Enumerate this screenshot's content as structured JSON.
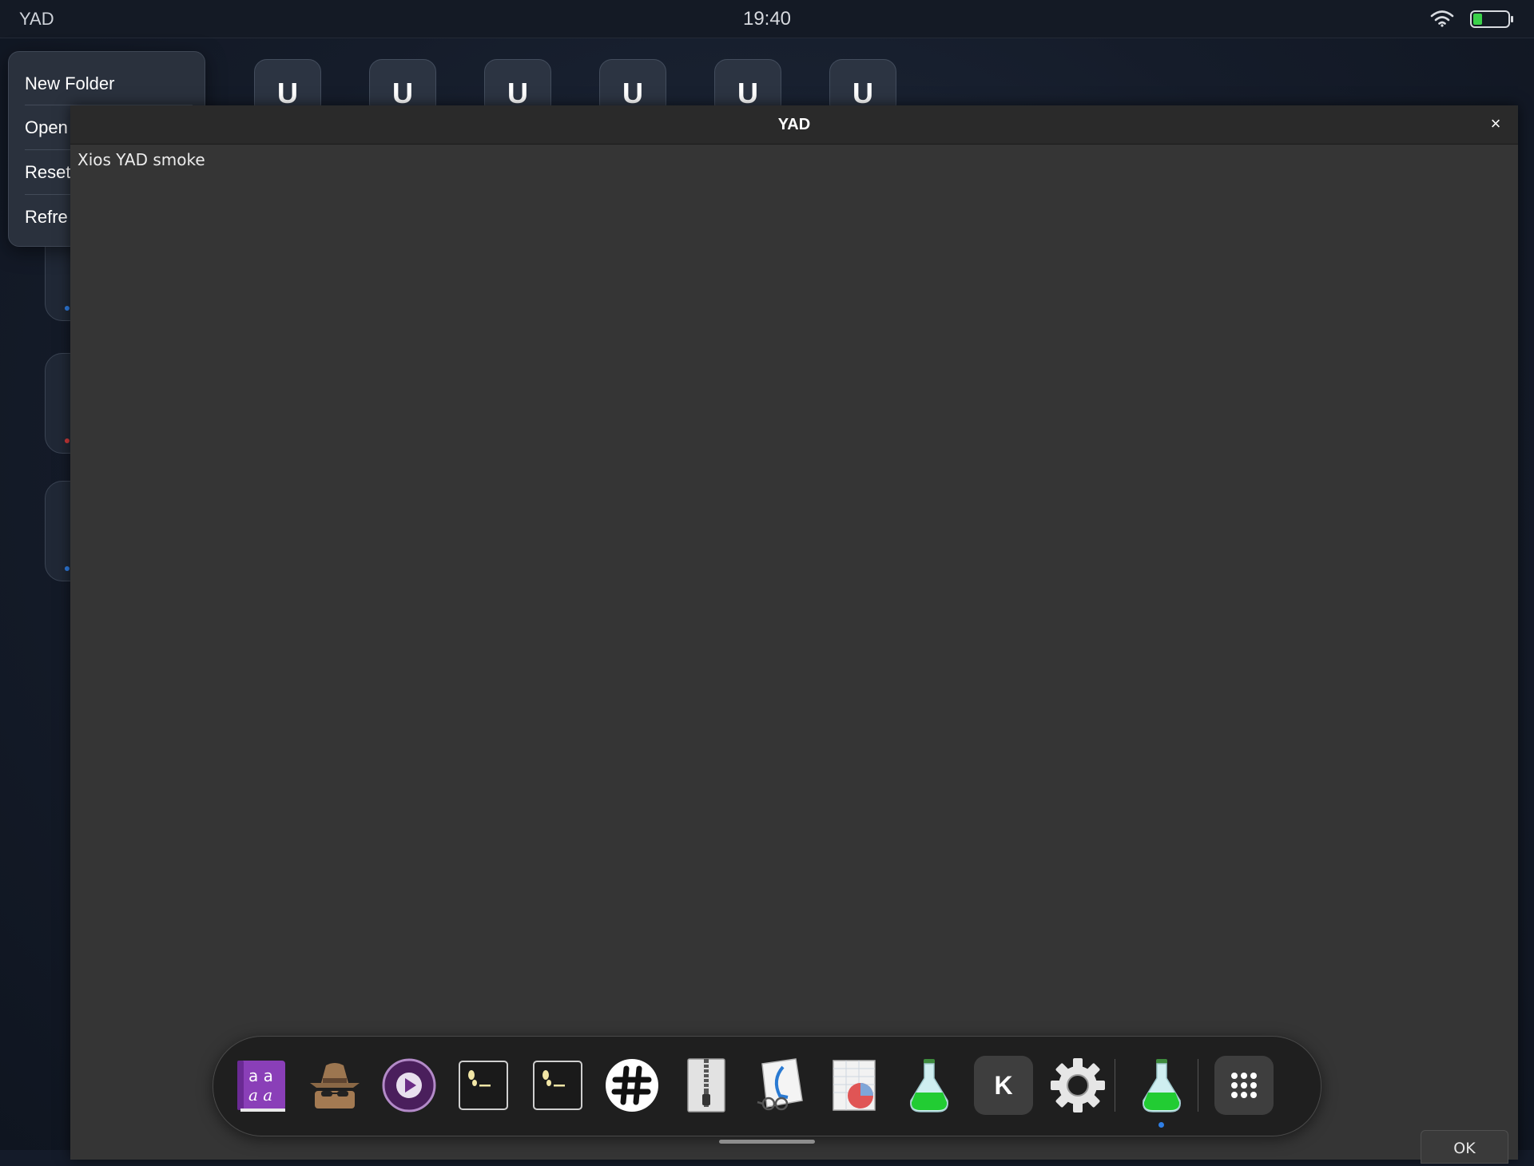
{
  "status_bar": {
    "app_name": "YAD",
    "time": "19:40",
    "wifi_icon": "wifi-icon",
    "battery_icon": "battery-icon",
    "battery_level": 0.25
  },
  "background": {
    "tiles": [
      "U",
      "U",
      "U",
      "U",
      "U",
      "U"
    ]
  },
  "context_menu": {
    "items": [
      "New Folder",
      "Open",
      "Reset",
      "Refre"
    ]
  },
  "dialog": {
    "title": "YAD",
    "close_label": "×",
    "text": "Xios YAD smoke",
    "ok_label": "OK"
  },
  "dock": {
    "items": [
      {
        "icon": "font-viewer-icon"
      },
      {
        "icon": "spy-hat-icon"
      },
      {
        "icon": "media-player-icon"
      },
      {
        "icon": "terminal-icon"
      },
      {
        "icon": "terminal-icon"
      },
      {
        "icon": "hashtag-icon"
      },
      {
        "icon": "archive-zipper-icon"
      },
      {
        "icon": "document-viewer-icon"
      },
      {
        "icon": "spreadsheet-chart-icon"
      },
      {
        "icon": "flask-icon"
      },
      {
        "icon": "k-app-icon",
        "label": "K"
      },
      {
        "icon": "gear-icon"
      },
      {
        "icon": "flask-icon",
        "running": true
      },
      {
        "icon": "app-grid-icon"
      }
    ]
  },
  "colors": {
    "accent": "#2f7fe6",
    "battery_fill": "#3bd14a",
    "window_bg": "#353535"
  }
}
